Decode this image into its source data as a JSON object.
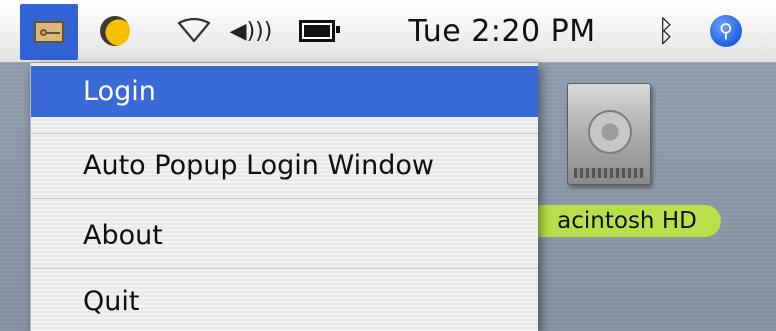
{
  "menubar": {
    "extra_icon": "key-icon",
    "moon_icon": "moon-icon",
    "wifi_icon": "wifi-icon",
    "volume_icon": "volume-icon",
    "battery_icon": "battery-icon",
    "clock": "Tue 2:20 PM",
    "bluetooth_icon": "bluetooth-icon",
    "spotlight_icon": "spotlight-icon",
    "accent_color": "#2f63d6"
  },
  "menu": {
    "items": [
      {
        "label": "Login",
        "selected": true
      },
      {
        "label": "Auto Popup Login Window",
        "selected": false
      },
      {
        "label": "About",
        "selected": false
      },
      {
        "label": "Quit",
        "selected": false
      }
    ],
    "highlight_color": "#3969d7"
  },
  "desktop": {
    "drive_label": "acintosh HD",
    "label_color": "#b9df4a"
  }
}
